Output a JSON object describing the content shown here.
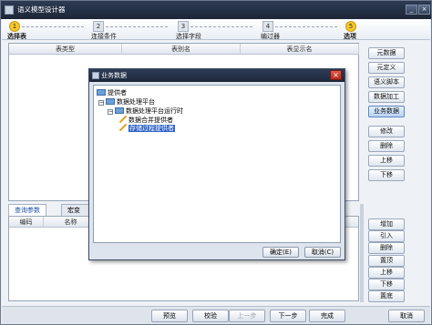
{
  "window": {
    "title": "语义模型设计器",
    "min": "_",
    "close": "×"
  },
  "steps": [
    {
      "num": "1",
      "label": "选择表",
      "active": true
    },
    {
      "num": "2",
      "label": "连接条件",
      "active": false
    },
    {
      "num": "3",
      "label": "选择字段",
      "active": false
    },
    {
      "num": "4",
      "label": "编过器",
      "active": false
    },
    {
      "num": "5",
      "label": "选项",
      "active": true
    }
  ],
  "table": {
    "columns": [
      "表类型",
      "表别名",
      "表显示名"
    ]
  },
  "right_buttons": [
    "元数据",
    "元定义",
    "语义脚本",
    "数据加工",
    "业务数据",
    "修改",
    "删除",
    "上移",
    "下移"
  ],
  "lower_tabs": [
    "查询参数",
    "宏变量"
  ],
  "param_table": {
    "columns": [
      "编码",
      "名称"
    ]
  },
  "param_buttons": [
    "增加",
    "引入",
    "删除",
    "置顶",
    "上移",
    "下移",
    "置底"
  ],
  "bottom_buttons": [
    "预览",
    "校验",
    "上一步",
    "下一步",
    "完成",
    "取消"
  ],
  "dialog": {
    "title": "业务数据",
    "tree": {
      "root": "提供者",
      "child": "数据处理平台",
      "grandchild": "数据处理平台运行时",
      "leaves": [
        "数据合并提供者",
        "存储过程提供者"
      ]
    },
    "ok": "确定(E)",
    "cancel": "取消(C)"
  }
}
